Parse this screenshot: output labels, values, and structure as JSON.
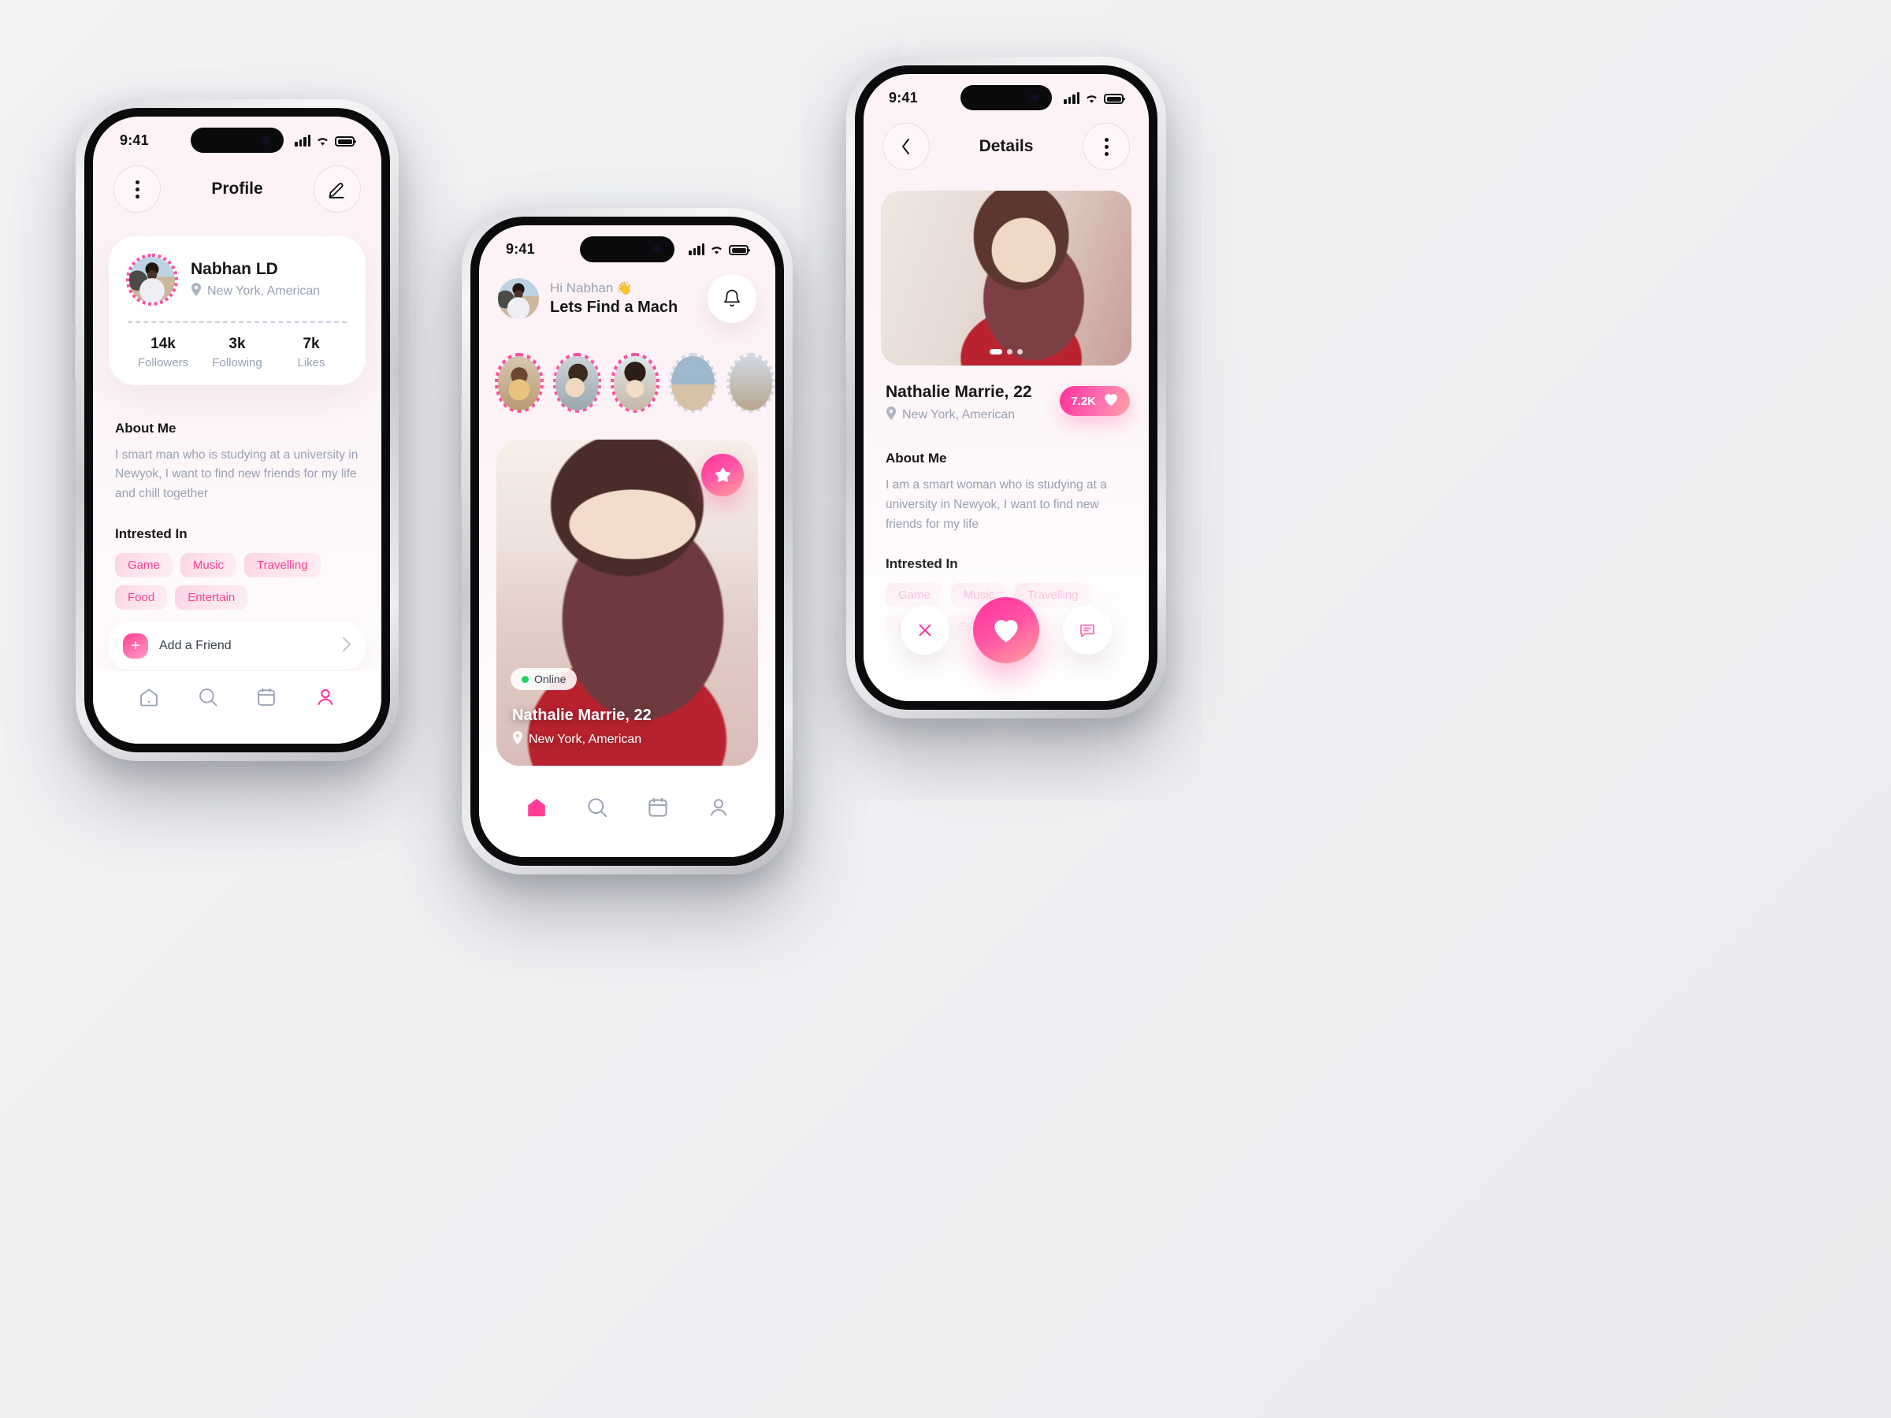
{
  "status_bar": {
    "time": "9:41",
    "signal_icon": "cellular-bars-icon",
    "wifi_icon": "wifi-icon",
    "battery_icon": "battery-icon"
  },
  "colors": {
    "accent_pink": "#ff2f9a",
    "accent_pink_light": "#ff9ec6",
    "muted_text": "#98a0b3",
    "dark_text": "#16161a",
    "online_green": "#1ed760"
  },
  "profile_screen": {
    "menu_icon": "more-vertical-icon",
    "title": "Profile",
    "edit_icon": "pencil-edit-icon",
    "user": {
      "name": "Nabhan LD",
      "location": "New York, American",
      "location_icon": "map-pin-icon",
      "avatar_icon": "user-avatar"
    },
    "stats": [
      {
        "value": "14k",
        "label": "Followers"
      },
      {
        "value": "3k",
        "label": "Following"
      },
      {
        "value": "7k",
        "label": "Likes"
      }
    ],
    "about": {
      "heading": "About Me",
      "text": "I  smart man who is studying at a university in Newyok, I want to find new friends for my life and chill together"
    },
    "interests": {
      "heading": "Intrested In",
      "tags": [
        "Game",
        "Music",
        "Travelling",
        "Food",
        "Entertain"
      ]
    },
    "add_friend": {
      "label": "Add a Friend",
      "plus_icon": "plus-icon",
      "chevron_icon": "chevron-right-icon"
    },
    "tabs": [
      {
        "name": "home",
        "icon": "home-icon",
        "active": false
      },
      {
        "name": "search",
        "icon": "search-icon",
        "active": false
      },
      {
        "name": "calendar",
        "icon": "calendar-icon",
        "active": false
      },
      {
        "name": "profile",
        "icon": "person-icon",
        "active": true
      }
    ]
  },
  "home_screen": {
    "greeting_small": "Hi Nabhan",
    "greeting_emoji": "👋",
    "greeting_big": "Lets Find a Mach",
    "avatar_icon": "user-avatar",
    "bell_icon": "bell-notification-icon",
    "stories": [
      {
        "name": "story-1",
        "ring": "active"
      },
      {
        "name": "story-2",
        "ring": "active"
      },
      {
        "name": "story-3",
        "ring": "active"
      },
      {
        "name": "story-4",
        "ring": "inactive"
      },
      {
        "name": "story-5",
        "ring": "inactive"
      }
    ],
    "match_card": {
      "star_icon": "star-icon",
      "online_label": "Online",
      "name": "Nathalie Marrie, 22",
      "location": "New York, American",
      "location_icon": "map-pin-icon"
    },
    "tabs": [
      {
        "name": "home",
        "icon": "home-icon",
        "active": true
      },
      {
        "name": "search",
        "icon": "search-icon",
        "active": false
      },
      {
        "name": "calendar",
        "icon": "calendar-icon",
        "active": false
      },
      {
        "name": "profile",
        "icon": "person-icon",
        "active": false
      }
    ]
  },
  "details_screen": {
    "back_icon": "chevron-left-icon",
    "title": "Details",
    "menu_icon": "more-vertical-icon",
    "carousel_dots": {
      "count": 3,
      "active_index": 0
    },
    "user": {
      "name": "Nathalie Marrie, 22",
      "location": "New York, American",
      "location_icon": "map-pin-icon",
      "likes_badge": "7.2K",
      "likes_icon": "heart-icon"
    },
    "about": {
      "heading": "About Me",
      "text": "I am a smart woman who is studying at a university in Newyok, I want to find new friends for my life"
    },
    "interests": {
      "heading": "Intrested In",
      "tags": [
        "Game",
        "Music",
        "Travelling",
        "Food",
        "Entertain"
      ]
    },
    "actions": [
      {
        "name": "dislike",
        "icon": "close-x-icon"
      },
      {
        "name": "like",
        "icon": "heart-icon"
      },
      {
        "name": "message",
        "icon": "chat-bubble-icon"
      }
    ]
  }
}
